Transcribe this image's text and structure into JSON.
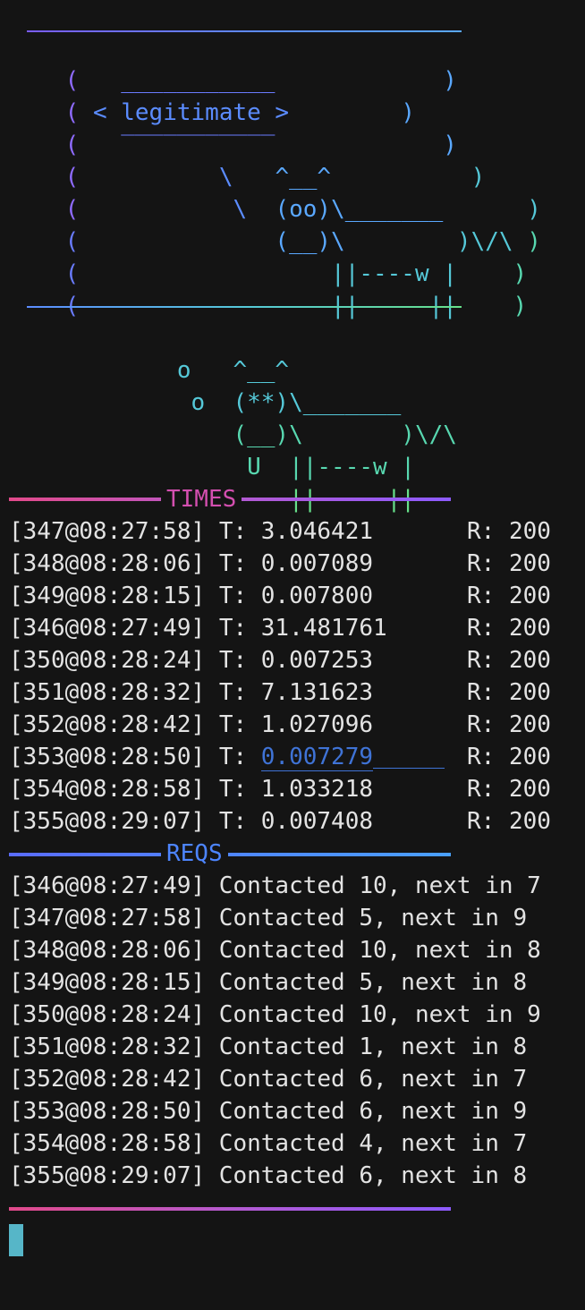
{
  "cowsay": {
    "bubble_text": "< legitimate >",
    "art_lines": [
      "(   ___________         )",
      "( < legitimate >        )",
      "(   ‾‾‾‾‾‾‾‾‾‾‾         )",
      "(         \\   ^__^      )",
      "(          \\  (oo)\\_______      )",
      "(             (__)\\       )\\/\\ )",
      "(                 ||----w |     )",
      "(                 ||     ||     )"
    ],
    "cow2_lines": [
      "        o   ^__^",
      "         o  (**)\\_______",
      "            (__)\\       )\\/\\",
      "             U  ||----w |",
      "                ||     ||"
    ]
  },
  "sections": {
    "times_title": "TIMES",
    "reqs_title": "REQS"
  },
  "times": [
    {
      "tag": "[347@08:27:58]",
      "t_label": "T:",
      "t": "3.046421",
      "r_label": "R:",
      "r": "200"
    },
    {
      "tag": "[348@08:28:06]",
      "t_label": "T:",
      "t": "0.007089",
      "r_label": "R:",
      "r": "200"
    },
    {
      "tag": "[349@08:28:15]",
      "t_label": "T:",
      "t": "0.007800",
      "r_label": "R:",
      "r": "200"
    },
    {
      "tag": "[346@08:27:49]",
      "t_label": "T:",
      "t": "31.481761",
      "r_label": "R:",
      "r": "200"
    },
    {
      "tag": "[350@08:28:24]",
      "t_label": "T:",
      "t": "0.007253",
      "r_label": "R:",
      "r": "200"
    },
    {
      "tag": "[351@08:28:32]",
      "t_label": "T:",
      "t": "7.131623",
      "r_label": "R:",
      "r": "200"
    },
    {
      "tag": "[352@08:28:42]",
      "t_label": "T:",
      "t": "1.027096",
      "r_label": "R:",
      "r": "200"
    },
    {
      "tag": "[353@08:28:50]",
      "t_label": "T:",
      "t": "0.007279",
      "r_label": "R:",
      "r": "200"
    },
    {
      "tag": "[354@08:28:58]",
      "t_label": "T:",
      "t": "1.033218",
      "r_label": "R:",
      "r": "200"
    },
    {
      "tag": "[355@08:29:07]",
      "t_label": "T:",
      "t": "0.007408",
      "r_label": "R:",
      "r": "200"
    }
  ],
  "reqs": [
    "[346@08:27:49] Contacted 10, next in 7",
    "[347@08:27:58] Contacted 5, next in 9",
    "[348@08:28:06] Contacted 10, next in 8",
    "[349@08:28:15] Contacted 5, next in 8",
    "[350@08:28:24] Contacted 10, next in 9",
    "[351@08:28:32] Contacted 1, next in 8",
    "[352@08:28:42] Contacted 6, next in 7",
    "[353@08:28:50] Contacted 6, next in 9",
    "[354@08:28:58] Contacted 4, next in 7",
    "[355@08:29:07] Contacted 6, next in 8"
  ],
  "colors": {
    "background": "#141414",
    "text": "#e3e3e3",
    "times_title": "#d44fb0",
    "reqs_title": "#4d85ff",
    "highlight": "#3f73d6",
    "cursor": "#56b6c8"
  }
}
